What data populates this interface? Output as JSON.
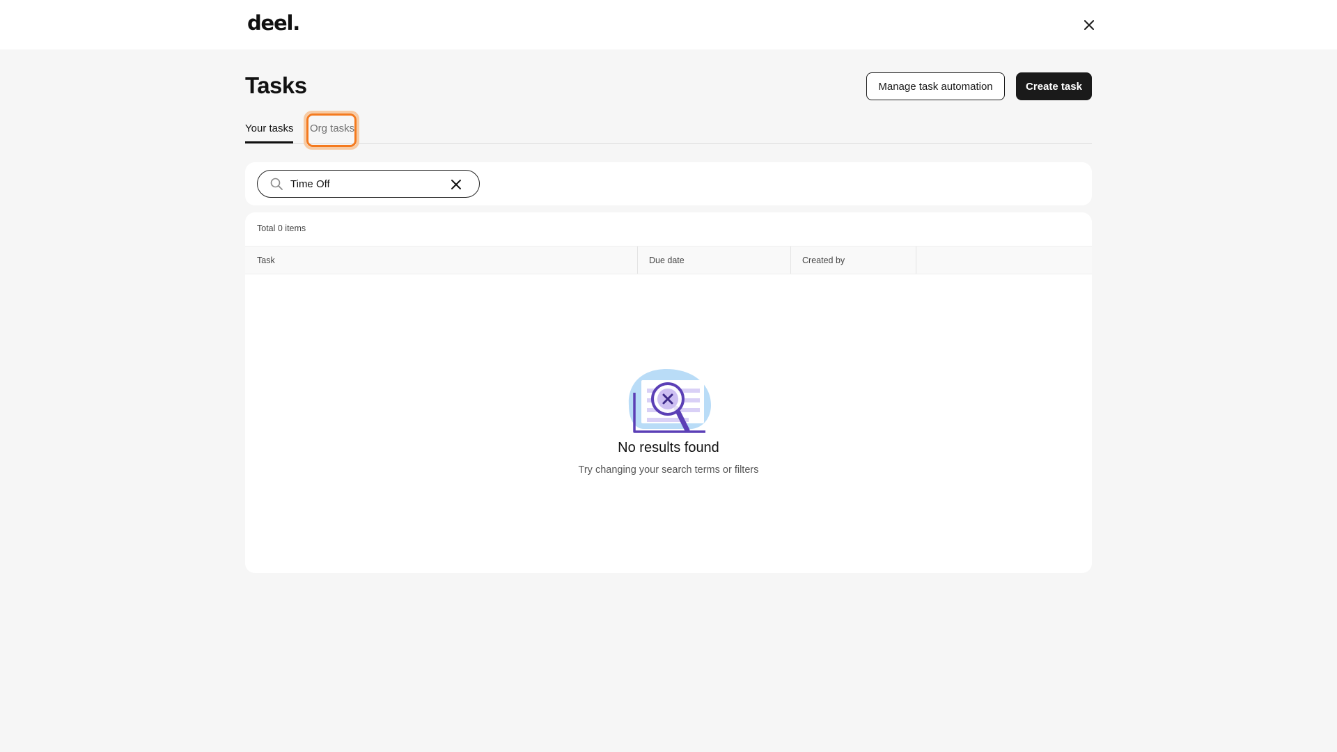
{
  "brand": {
    "logo_text": "deel."
  },
  "header": {
    "close_icon": "close-icon"
  },
  "page": {
    "title": "Tasks",
    "actions": {
      "manage_label": "Manage task automation",
      "create_label": "Create task"
    }
  },
  "tabs": [
    {
      "label": "Your tasks",
      "active": true
    },
    {
      "label": "Org tasks",
      "active": false,
      "highlighted": true
    }
  ],
  "search": {
    "value": "Time Off",
    "icon": "search-icon",
    "clear_icon": "clear-icon"
  },
  "table": {
    "total_text": "Total 0 items",
    "columns": [
      "Task",
      "Due date",
      "Created by",
      ""
    ],
    "rows": []
  },
  "empty_state": {
    "illustration": "no-results-illustration",
    "title": "No results found",
    "subtitle": "Try changing your search terms or filters"
  },
  "colors": {
    "page_bg": "#f6f6f6",
    "primary_button": "#1a1a1a",
    "highlight_ring": "#f47a1f",
    "illustration_purple": "#5b3fb6",
    "illustration_blue": "#b9dcf7"
  }
}
